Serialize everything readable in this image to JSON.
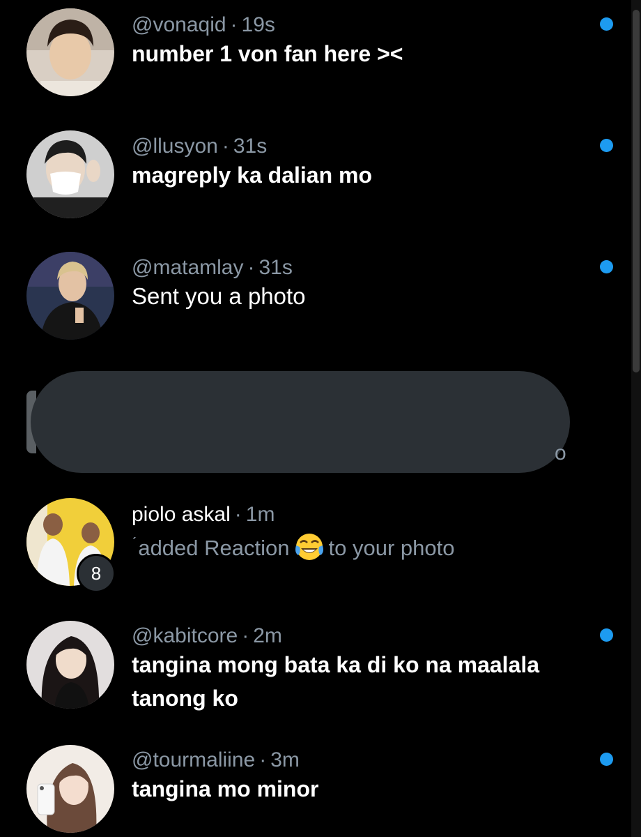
{
  "conversations": [
    {
      "handle": "@vonaqid",
      "time": "19s",
      "message": "number 1 von fan here ><",
      "unread": true,
      "avatar": "avatar-young-man"
    },
    {
      "handle": "@llusyon",
      "time": "31s",
      "message": "magreply ka dalian mo",
      "unread": true,
      "avatar": "avatar-masked-person"
    },
    {
      "handle": "@matamlay",
      "time": "31s",
      "message": "Sent you a photo",
      "unread": true,
      "avatar": "avatar-blond-man"
    },
    {
      "name": "piolo askal",
      "time": "1m",
      "message_pre": "added Reaction",
      "reaction_icon": "tears-of-joy-emoji",
      "message_post": "to your photo",
      "badge": "8",
      "unread": false,
      "avatar": "avatar-group-photo"
    },
    {
      "handle": "@kabitcore",
      "time": "2m",
      "message_line1": "tangina mong bata ka di ko na maalala",
      "message_line2": "tanong ko",
      "unread": true,
      "avatar": "avatar-dark-hair-woman"
    },
    {
      "handle": "@tourmaliine",
      "time": "3m",
      "message": "tangina mo minor",
      "unread": true,
      "avatar": "avatar-selfie-woman"
    }
  ],
  "redacted_partial_glyph": "o",
  "dot_separator": "·",
  "colors": {
    "background": "#000000",
    "primary_text": "#ffffff",
    "secondary_text": "#8b98a5",
    "unread_dot": "#1d9bf0",
    "redaction": "#2b3035"
  }
}
